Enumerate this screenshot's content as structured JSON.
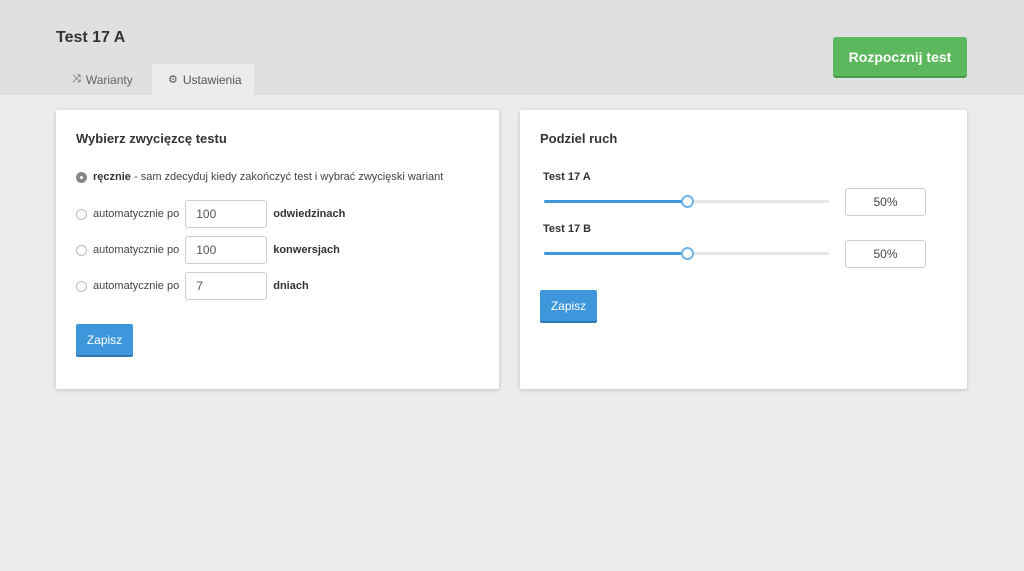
{
  "header": {
    "title": "Test 17 A",
    "start_button": "Rozpocznij test",
    "start_button_color": "#5cb85c",
    "tabs": [
      {
        "label": "Warianty",
        "icon": "shuffle-icon",
        "active": false
      },
      {
        "label": "Ustawienia",
        "icon": "gear-icon",
        "active": true
      }
    ]
  },
  "winner": {
    "title": "Wybierz zwycięzcę testu",
    "manual": {
      "bold": "ręcznie",
      "rest": " - sam zdecyduj kiedy zakończyć test i wybrać zwycięski wariant",
      "checked": true
    },
    "options": [
      {
        "prefix": "automatycznie po",
        "value": "100",
        "unit": "odwiedzinach",
        "checked": false
      },
      {
        "prefix": "automatycznie po",
        "value": "100",
        "unit": "konwersjach",
        "checked": false
      },
      {
        "prefix": "automatycznie po",
        "value": "7",
        "unit": "dniach",
        "checked": false
      }
    ],
    "save_label": "Zapisz"
  },
  "traffic": {
    "title": "Podziel ruch",
    "variants": [
      {
        "name": "Test 17 A",
        "percent_label": "50%",
        "value": 0.5
      },
      {
        "name": "Test 17 B",
        "percent_label": "50%",
        "value": 0.5
      }
    ],
    "save_label": "Zapisz",
    "accent": "#3f97db"
  }
}
